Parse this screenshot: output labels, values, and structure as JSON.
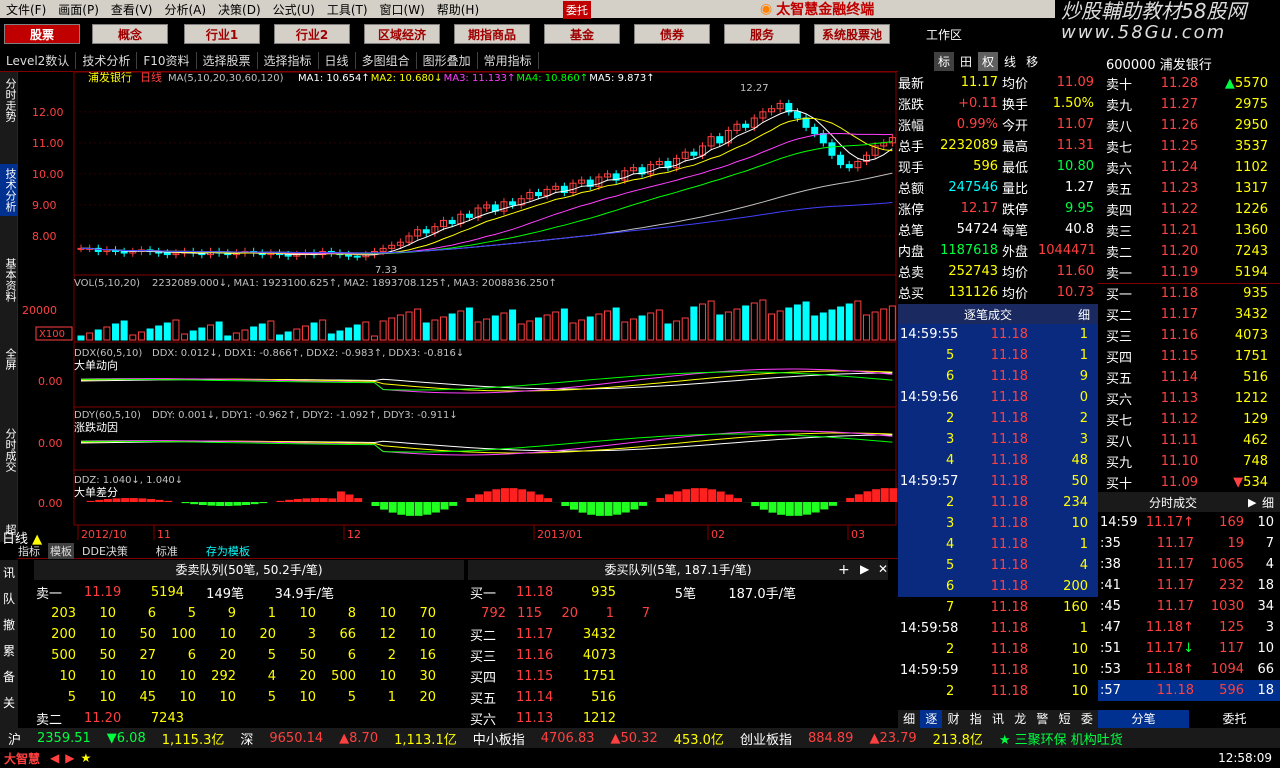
{
  "menu": {
    "items": [
      "文件(F)",
      "画面(P)",
      "查看(V)",
      "分析(A)",
      "决策(D)",
      "公式(U)",
      "工具(T)",
      "窗口(W)",
      "帮助(H)"
    ],
    "weituo": "委托",
    "brand": "太智慧金融终端",
    "ad_line1": "炒股輔助教材58股网",
    "ad_line2": "www.58Gu.com"
  },
  "nav": {
    "items": [
      "股票",
      "概念",
      "行业1",
      "行业2",
      "区域经济",
      "期指商品",
      "基金",
      "债券",
      "服务",
      "系统股票池"
    ],
    "workarea": "工作区"
  },
  "toolbar": {
    "items": [
      "Level2数认",
      "技术分析",
      "F10资料",
      "选择股票",
      "选择指标",
      "日线",
      "多图组合",
      "图形叠加",
      "常用指标"
    ],
    "tabs": [
      "标",
      "田",
      "权",
      "线",
      "移"
    ]
  },
  "leftnav": [
    "分时走势",
    "技术分析",
    "基本资料",
    "全屏",
    "分时成交",
    "超短线"
  ],
  "chart": {
    "stock": "浦发银行",
    "period": "日线",
    "ma_line": "MA(5,10,20,30,60,120)",
    "ma_values": [
      {
        "label": "MA1: 10.654↑",
        "color": "#ffffff"
      },
      {
        "label": "MA2: 10.680↓",
        "color": "#ffff00"
      },
      {
        "label": "MA3: 11.133↑",
        "color": "#ff40ff"
      },
      {
        "label": "MA4: 10.860↑",
        "color": "#00ff00"
      },
      {
        "label": "MA5: 9.873↑",
        "color": "#ffffff"
      }
    ],
    "price_ticks": [
      "12.00",
      "11.00",
      "10.00",
      "9.00",
      "8.00"
    ],
    "high_label": "12.27",
    "low_label": "7.33",
    "vol_line": "VOL(5,10,20)",
    "vol_values": "2232089.000↓, MA1: 1923100.625↑, MA2: 1893708.125↑, MA3: 2008836.250↑",
    "vol_tick": "20000",
    "vol_unit": "X100",
    "ddx_line": "DDX(60,5,10)",
    "ddx_values": "DDX: 0.012↓, DDX1: -0.866↑, DDX2: -0.983↑, DDX3: -0.816↓",
    "ddx_name": "大单动向",
    "ddx_tick": "0.00",
    "ddy_line": "DDY(60,5,10)",
    "ddy_values": "DDY: 0.001↓, DDY1: -0.962↑, DDY2: -1.092↑, DDY3: -0.911↓",
    "ddy_name": "涨跌动因",
    "ddy_tick": "0.00",
    "ddz_line": "DDZ: 1.040↓, 1.040↓",
    "ddz_name": "大单差分",
    "ddz_tick": "0.00",
    "dates": [
      "2012/10",
      "11",
      "12",
      "2013/01",
      "02",
      "03"
    ]
  },
  "chart_data": {
    "type": "candlestick",
    "title": "浦发银行 日线",
    "ylim": [
      7.0,
      12.8
    ],
    "close": [
      7.6,
      7.6,
      7.5,
      7.55,
      7.5,
      7.45,
      7.5,
      7.55,
      7.5,
      7.45,
      7.4,
      7.45,
      7.5,
      7.45,
      7.4,
      7.5,
      7.45,
      7.4,
      7.45,
      7.5,
      7.45,
      7.4,
      7.45,
      7.4,
      7.35,
      7.4,
      7.45,
      7.4,
      7.5,
      7.45,
      7.4,
      7.35,
      7.33,
      7.4,
      7.5,
      7.6,
      7.7,
      7.8,
      8.0,
      8.2,
      8.1,
      8.3,
      8.5,
      8.4,
      8.7,
      8.6,
      8.9,
      9.0,
      8.8,
      9.1,
      9.0,
      9.2,
      9.4,
      9.3,
      9.5,
      9.6,
      9.4,
      9.7,
      9.8,
      9.6,
      9.9,
      10.0,
      9.8,
      10.1,
      10.2,
      10.0,
      10.3,
      10.4,
      10.2,
      10.5,
      10.7,
      10.6,
      10.9,
      11.2,
      11.0,
      11.4,
      11.6,
      11.5,
      11.8,
      12.0,
      12.1,
      12.27,
      12.0,
      11.8,
      11.5,
      11.3,
      11.0,
      10.6,
      10.3,
      10.2,
      10.4,
      10.6,
      10.9,
      11.0,
      11.17
    ]
  },
  "sidebar": {
    "rows": [
      {
        "k": "最新",
        "v": "11.17",
        "vc": "yellow",
        "k2": "均价",
        "v2": "11.09",
        "v2c": "red"
      },
      {
        "k": "涨跌",
        "v": "+0.11",
        "vc": "red",
        "k2": "换手",
        "v2": "1.50%",
        "v2c": "yellow"
      },
      {
        "k": "涨幅",
        "v": "0.99%",
        "vc": "red",
        "k2": "今开",
        "v2": "11.07",
        "v2c": "red"
      },
      {
        "k": "总手",
        "v": "2232089",
        "vc": "yellow",
        "k2": "最高",
        "v2": "11.31",
        "v2c": "red"
      },
      {
        "k": "现手",
        "v": "596",
        "vc": "yellow",
        "k2": "最低",
        "v2": "10.80",
        "v2c": "green"
      },
      {
        "k": "总额",
        "v": "247546",
        "vc": "cyan",
        "k2": "量比",
        "v2": "1.27",
        "v2c": "white"
      },
      {
        "k": "涨停",
        "v": "12.17",
        "vc": "red",
        "k2": "跌停",
        "v2": "9.95",
        "v2c": "green"
      },
      {
        "k": "总笔",
        "v": "54724",
        "vc": "white",
        "k2": "每笔",
        "v2": "40.8",
        "v2c": "white"
      },
      {
        "k": "内盘",
        "v": "1187618",
        "vc": "green",
        "k2": "外盘",
        "v2": "1044471",
        "v2c": "red"
      },
      {
        "k": "总卖",
        "v": "252743",
        "vc": "yellow",
        "k2": "均价",
        "v2": "11.60",
        "v2c": "red"
      },
      {
        "k": "总买",
        "v": "131126",
        "vc": "yellow",
        "k2": "均价",
        "v2": "10.73",
        "v2c": "red"
      }
    ]
  },
  "ticks": {
    "title": "逐笔成交",
    "tab": "细",
    "rows": [
      {
        "t": "14:59:55",
        "p": "11.18",
        "v": "1"
      },
      {
        "t": "",
        "p": "11.18",
        "v": "1"
      },
      {
        "t": "",
        "p": "11.18",
        "v": "9"
      },
      {
        "t": "14:59:56",
        "p": "11.18",
        "v": "0"
      },
      {
        "t": "",
        "p": "11.18",
        "v": "2"
      },
      {
        "t": "",
        "p": "11.18",
        "v": "3"
      },
      {
        "t": "",
        "p": "11.18",
        "v": "48"
      },
      {
        "t": "14:59:57",
        "p": "11.18",
        "v": "50"
      },
      {
        "t": "",
        "p": "11.18",
        "v": "234"
      },
      {
        "t": "",
        "p": "11.18",
        "v": "10"
      },
      {
        "t": "",
        "p": "11.18",
        "v": "1"
      },
      {
        "t": "",
        "p": "11.18",
        "v": "4"
      },
      {
        "t": "",
        "p": "11.18",
        "v": "200"
      },
      {
        "t": "",
        "p": "11.18",
        "v": "160"
      },
      {
        "t": "14:59:58",
        "p": "11.18",
        "v": "1"
      },
      {
        "t": "",
        "p": "11.18",
        "v": "10"
      },
      {
        "t": "14:59:59",
        "p": "11.18",
        "v": "10"
      },
      {
        "t": "",
        "p": "11.18",
        "v": "10"
      }
    ],
    "seq": [
      "5",
      "6",
      "2",
      "3",
      "4",
      "2",
      "3",
      "4",
      "5",
      "6",
      "7",
      "2",
      "2"
    ],
    "tabs": [
      "细",
      "逐",
      "财",
      "指",
      "讯",
      "龙",
      "警",
      "短",
      "委"
    ]
  },
  "orderbook": {
    "code": "600000 浦发银行",
    "sells": [
      {
        "l": "卖十",
        "p": "11.28",
        "v": "5570",
        "arrow": "up"
      },
      {
        "l": "卖九",
        "p": "11.27",
        "v": "2975"
      },
      {
        "l": "卖八",
        "p": "11.26",
        "v": "2950"
      },
      {
        "l": "卖七",
        "p": "11.25",
        "v": "3537"
      },
      {
        "l": "卖六",
        "p": "11.24",
        "v": "1102"
      },
      {
        "l": "卖五",
        "p": "11.23",
        "v": "1317"
      },
      {
        "l": "卖四",
        "p": "11.22",
        "v": "1226"
      },
      {
        "l": "卖三",
        "p": "11.21",
        "v": "1360"
      },
      {
        "l": "卖二",
        "p": "11.20",
        "v": "7243"
      },
      {
        "l": "卖一",
        "p": "11.19",
        "v": "5194"
      }
    ],
    "buys": [
      {
        "l": "买一",
        "p": "11.18",
        "v": "935"
      },
      {
        "l": "买二",
        "p": "11.17",
        "v": "3432"
      },
      {
        "l": "买三",
        "p": "11.16",
        "v": "4073"
      },
      {
        "l": "买四",
        "p": "11.15",
        "v": "1751"
      },
      {
        "l": "买五",
        "p": "11.14",
        "v": "516"
      },
      {
        "l": "买六",
        "p": "11.13",
        "v": "1212"
      },
      {
        "l": "买七",
        "p": "11.12",
        "v": "129"
      },
      {
        "l": "买八",
        "p": "11.11",
        "v": "462"
      },
      {
        "l": "买九",
        "p": "11.10",
        "v": "748"
      },
      {
        "l": "买十",
        "p": "11.09",
        "v": "534",
        "arrow": "down"
      }
    ]
  },
  "rticks": {
    "title": "分时成交",
    "tab": "细",
    "rows": [
      {
        "t": "14:59",
        "p": "11.17",
        "a": "up",
        "v": "169",
        "n": "10"
      },
      {
        "t": ":35",
        "p": "11.17",
        "a": "",
        "v": "19",
        "n": "7"
      },
      {
        "t": ":38",
        "p": "11.17",
        "a": "",
        "v": "1065",
        "n": "4"
      },
      {
        "t": ":41",
        "p": "11.17",
        "a": "",
        "v": "232",
        "n": "18"
      },
      {
        "t": ":45",
        "p": "11.17",
        "a": "",
        "v": "1030",
        "n": "34"
      },
      {
        "t": ":47",
        "p": "11.18",
        "a": "up",
        "v": "125",
        "n": "3"
      },
      {
        "t": ":51",
        "p": "11.17",
        "a": "down",
        "v": "117",
        "n": "10"
      },
      {
        "t": ":53",
        "p": "11.18",
        "a": "up",
        "v": "1094",
        "n": "66"
      },
      {
        "t": ":57",
        "p": "11.18",
        "a": "",
        "v": "596",
        "n": "18"
      }
    ],
    "tabs": [
      "分笔",
      "委托"
    ]
  },
  "bottomtabs": [
    "指标",
    "模板",
    "DDE决策",
    "标准",
    "存为模板"
  ],
  "queues": {
    "sell_title": "委卖队列(50笔, 50.2手/笔)",
    "buy_title": "委买队列(5笔, 187.1手/笔)",
    "sidetabs": [
      "讯",
      "队",
      "撤",
      "累",
      "备",
      "关"
    ],
    "sell_head": {
      "l": "卖一",
      "p": "11.19",
      "v": "5194",
      "n": "149笔",
      "avg": "34.9手/笔"
    },
    "sell_rows": [
      [
        "203",
        "10",
        "6",
        "5",
        "9",
        "1",
        "10",
        "8",
        "10",
        "70"
      ],
      [
        "200",
        "10",
        "50",
        "100",
        "10",
        "20",
        "3",
        "66",
        "12",
        "10"
      ],
      [
        "500",
        "50",
        "27",
        "6",
        "20",
        "5",
        "50",
        "6",
        "2",
        "16"
      ],
      [
        "10",
        "10",
        "10",
        "10",
        "292",
        "4",
        "20",
        "500",
        "10",
        "30"
      ],
      [
        "5",
        "10",
        "45",
        "10",
        "10",
        "5",
        "10",
        "5",
        "1",
        "20"
      ]
    ],
    "sell2": {
      "l": "卖二",
      "p": "11.20",
      "v": "7243"
    },
    "buy_head": {
      "l": "买一",
      "p": "11.18",
      "v": "935",
      "n": "5笔",
      "avg": "187.0手/笔"
    },
    "buy_row": [
      "792",
      "115",
      "20",
      "1",
      "7"
    ],
    "buy_levels": [
      {
        "l": "买二",
        "p": "11.17",
        "v": "3432"
      },
      {
        "l": "买三",
        "p": "11.16",
        "v": "4073"
      },
      {
        "l": "买四",
        "p": "11.15",
        "v": "1751"
      },
      {
        "l": "买五",
        "p": "11.14",
        "v": "516"
      },
      {
        "l": "买六",
        "p": "11.13",
        "v": "1212"
      }
    ]
  },
  "statusbar": {
    "items": [
      {
        "t": "沪",
        "c": "white"
      },
      {
        "t": "2359.51",
        "c": "green"
      },
      {
        "t": "▼6.08",
        "c": "green"
      },
      {
        "t": "1,115.3亿",
        "c": "yellow"
      },
      {
        "t": "深",
        "c": "white"
      },
      {
        "t": "9650.14",
        "c": "red"
      },
      {
        "t": "▲8.70",
        "c": "red"
      },
      {
        "t": "1,113.1亿",
        "c": "yellow"
      },
      {
        "t": "中小板指",
        "c": "white"
      },
      {
        "t": "4706.83",
        "c": "red"
      },
      {
        "t": "▲50.32",
        "c": "red"
      },
      {
        "t": "453.0亿",
        "c": "yellow"
      },
      {
        "t": "创业板指",
        "c": "white"
      },
      {
        "t": "884.89",
        "c": "red"
      },
      {
        "t": "▲23.79",
        "c": "red"
      },
      {
        "t": "213.8亿",
        "c": "yellow"
      },
      {
        "t": "★ 三聚环保 机构吐货",
        "c": "green"
      }
    ],
    "clock": "12:58:09",
    "logo": "大智慧"
  }
}
